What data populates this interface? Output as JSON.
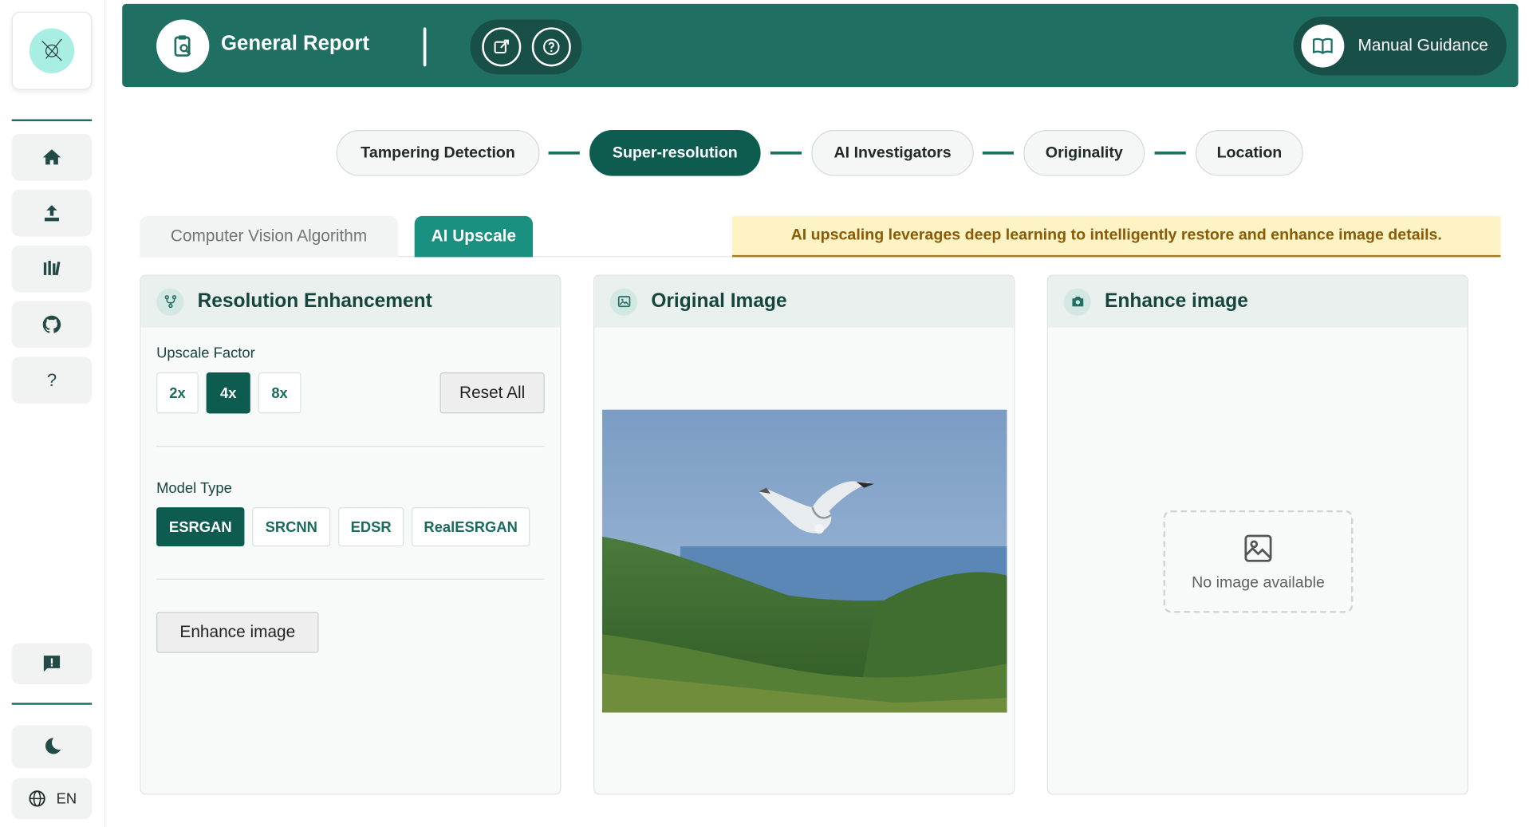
{
  "header": {
    "title": "General Report",
    "guide_label": "Manual Guidance"
  },
  "sidebar": {
    "items": [
      "home-icon",
      "upload-icon",
      "library-icon",
      "github-icon",
      "help-icon"
    ],
    "help_glyph": "?",
    "lang": "EN"
  },
  "steps": [
    {
      "label": "Tampering Detection",
      "active": false
    },
    {
      "label": "Super-resolution",
      "active": true
    },
    {
      "label": "AI Investigators",
      "active": false
    },
    {
      "label": "Originality",
      "active": false
    },
    {
      "label": "Location",
      "active": false
    }
  ],
  "tabs": {
    "inactive": "Computer Vision Algorithm",
    "active": "AI Upscale"
  },
  "banner": "AI upscaling leverages deep learning to intelligently restore and enhance image details.",
  "enhance_panel": {
    "title": "Resolution Enhancement",
    "upscale_label": "Upscale Factor",
    "factors": [
      "2x",
      "4x",
      "8x"
    ],
    "selected_factor": "4x",
    "reset_label": "Reset All",
    "model_label": "Model Type",
    "models": [
      "ESRGAN",
      "SRCNN",
      "EDSR",
      "RealESRGAN"
    ],
    "selected_model": "ESRGAN",
    "enhance_button": "Enhance image"
  },
  "original_panel": {
    "title": "Original Image"
  },
  "result_panel": {
    "title": "Enhance image",
    "empty_text": "No image available"
  },
  "colors": {
    "primary": "#1f6f62",
    "dark": "#0d5c4f",
    "accent": "#1a9080",
    "banner_bg": "#fdf3c4",
    "banner_text": "#8a5a05"
  }
}
